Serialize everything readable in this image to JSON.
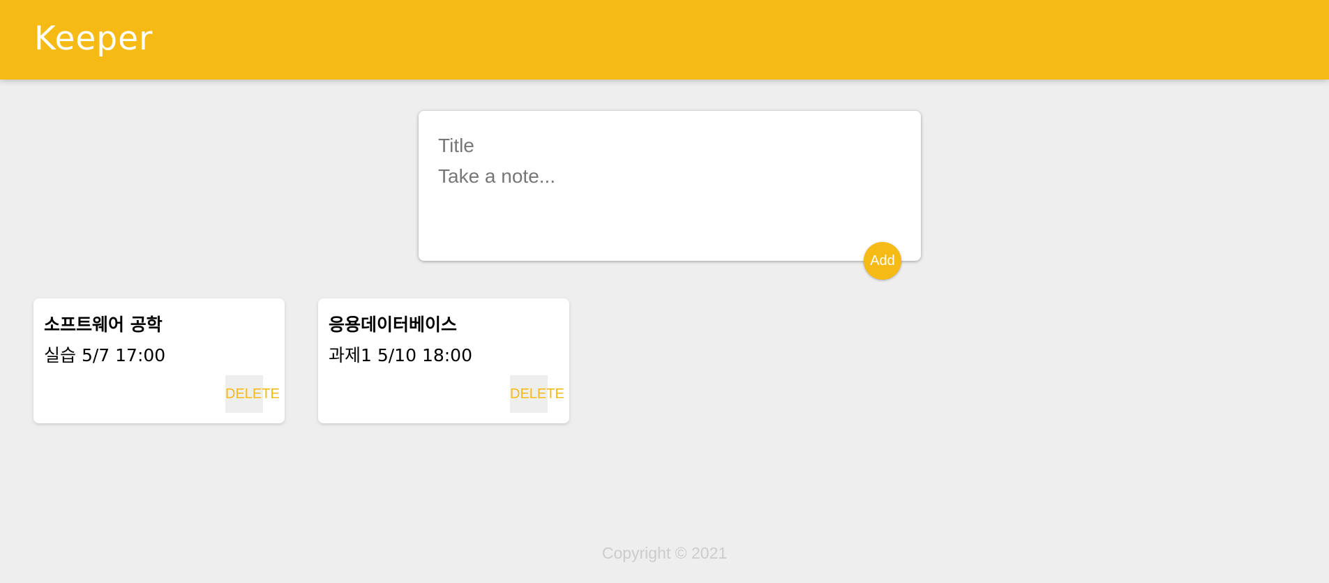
{
  "header": {
    "title": "Keeper"
  },
  "create_note": {
    "title_placeholder": "Title",
    "content_placeholder": "Take a note...",
    "add_label": "Add"
  },
  "notes": [
    {
      "title": "소프트웨어 공학",
      "content": "실습 5/7 17:00",
      "delete_label": "DELETE"
    },
    {
      "title": "응용데이터베이스",
      "content": "과제1 5/10 18:00",
      "delete_label": "DELETE"
    }
  ],
  "footer": {
    "text": "Copyright © 2021"
  },
  "colors": {
    "accent": "#f5ba13",
    "background": "#eeeeee",
    "card": "#ffffff",
    "placeholder": "#777777",
    "footer_text": "#cccccc"
  }
}
